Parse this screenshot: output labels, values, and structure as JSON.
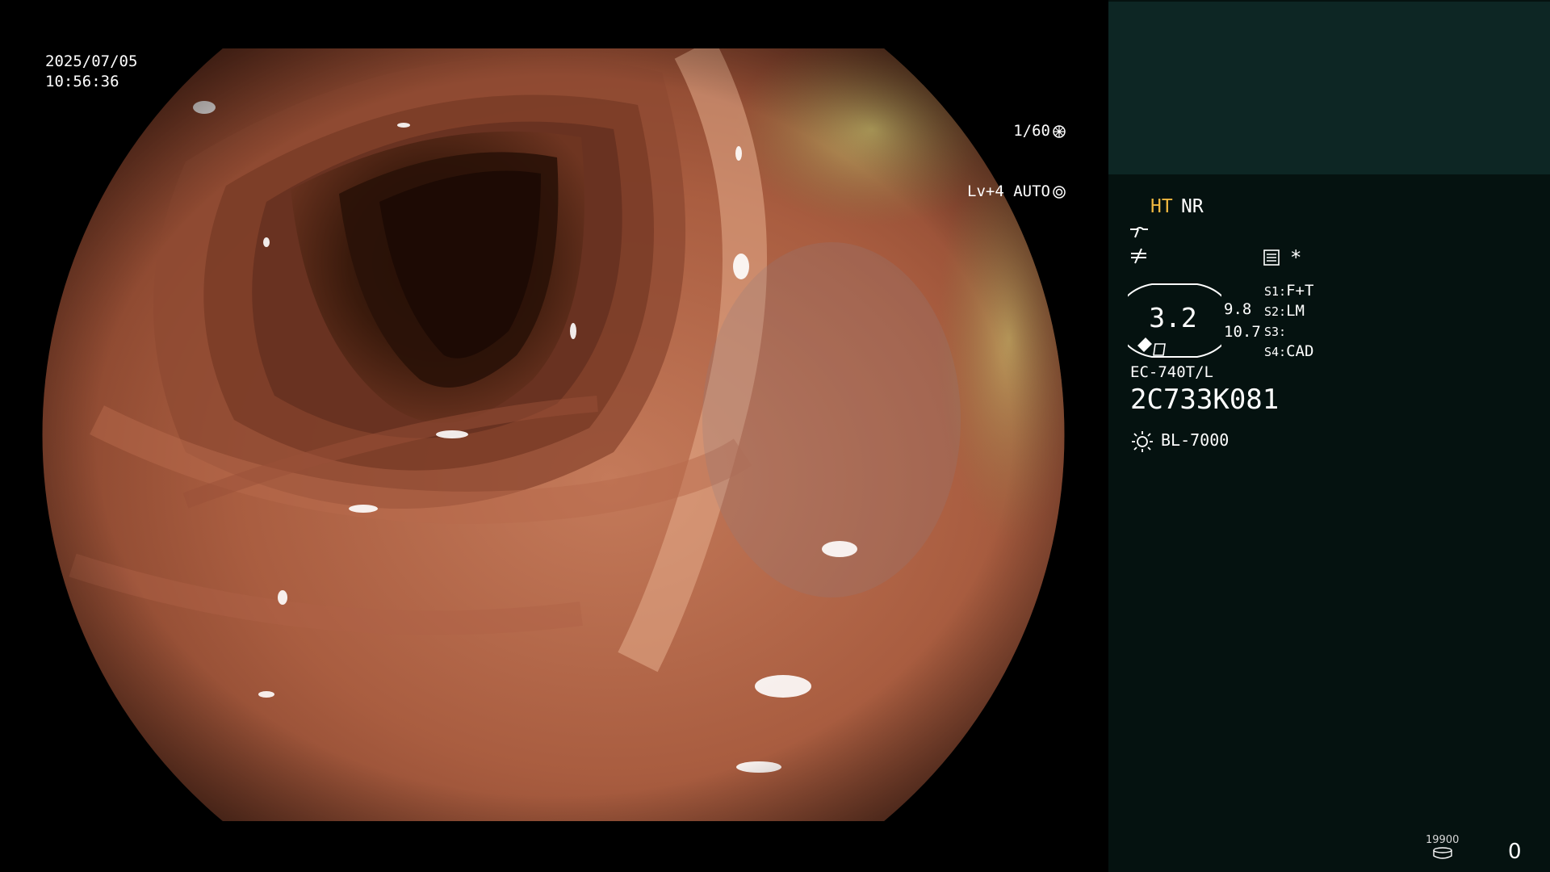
{
  "endoscope_view": {
    "date": "2025/07/05",
    "time": "10:56:36",
    "shutter": "1/60",
    "shutter_icon": "aperture-icon",
    "iris": "Lv+4 AUTO",
    "iris_icon": "iris-mode-icon"
  },
  "info_panel": {
    "modes": {
      "ht": "HT",
      "nr": "NR"
    },
    "icons": [
      "wave-icon",
      "filter-icon",
      "menu-icon",
      "asterisk-icon",
      "zoom-gauge-icon",
      "light-source-icon",
      "storage-icon"
    ],
    "star": "*",
    "zoom": "3.2",
    "distances": [
      "9.8",
      "10.7"
    ],
    "switches": [
      {
        "key": "S1:",
        "value": "F+T"
      },
      {
        "key": "S2:",
        "value": "LM"
      },
      {
        "key": "S3:",
        "value": ""
      },
      {
        "key": "S4:",
        "value": "CAD"
      }
    ],
    "scope_model": "EC-740T/L",
    "scope_serial": "2C733K081",
    "light_source": "BL-7000",
    "storage_remaining": "19900",
    "capture_count": "0"
  },
  "colors": {
    "panel_background": "#051210",
    "patient_area": "#0d2624",
    "ht_highlight": "#f0b840",
    "text": "#ffffff"
  }
}
